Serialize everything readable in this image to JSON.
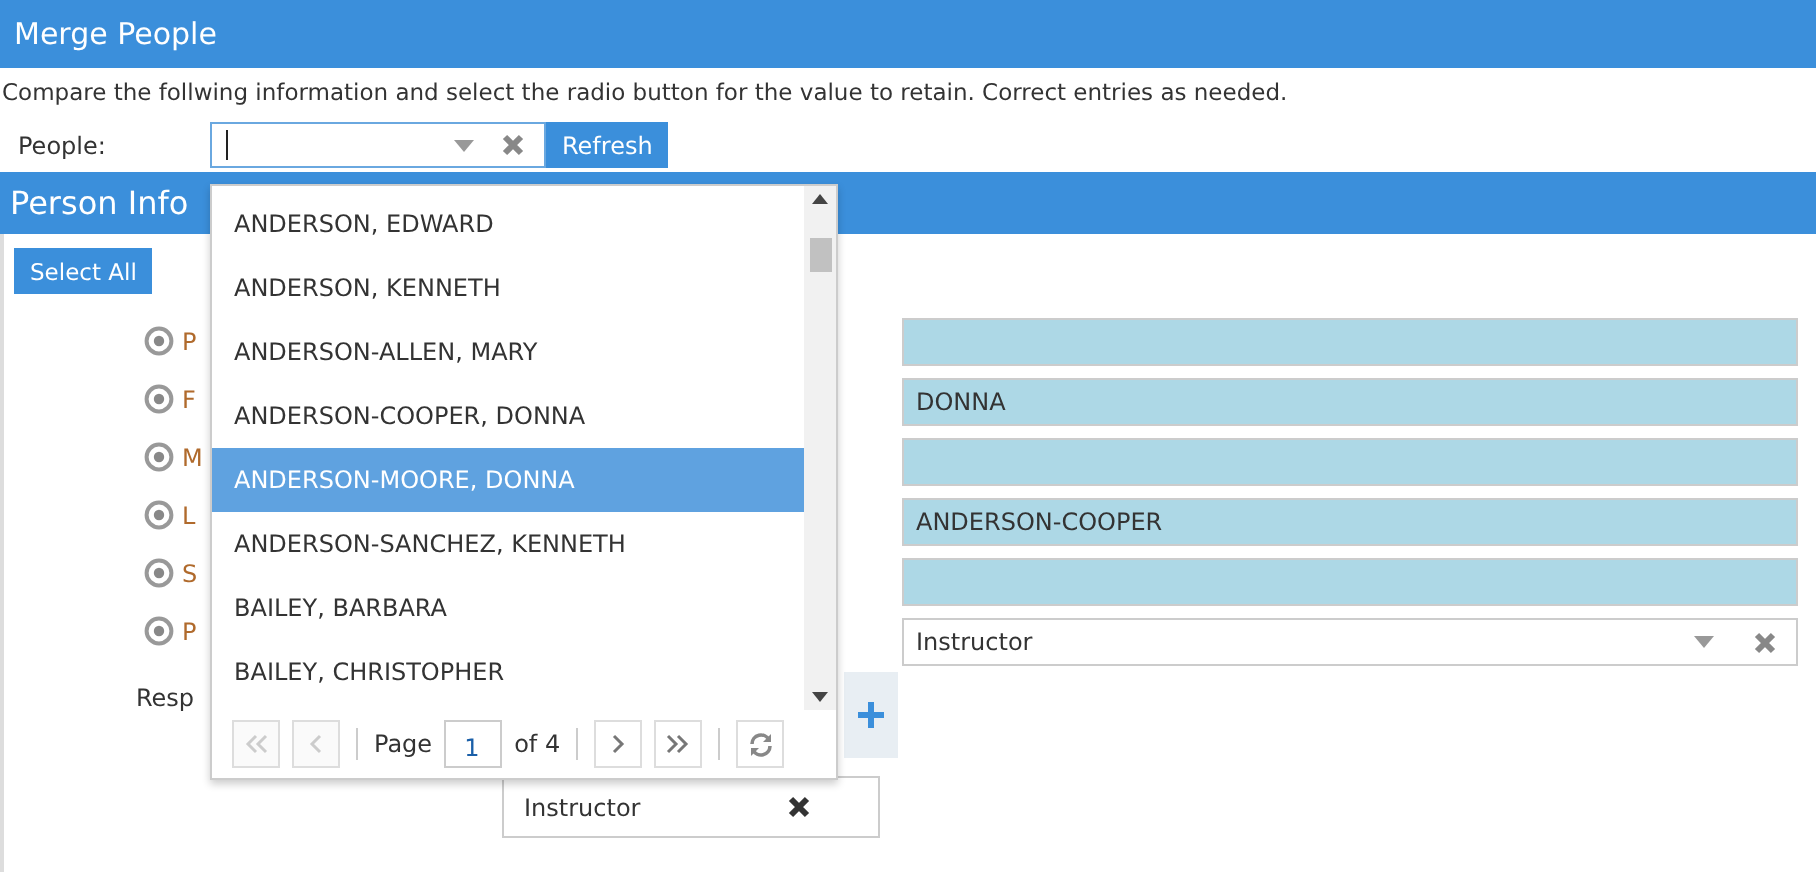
{
  "window": {
    "title": "Merge People"
  },
  "instructions": "Compare the follwing information and select the radio button for the value to retain. Correct entries as needed.",
  "people_field": {
    "label": "People:",
    "button": "Refresh"
  },
  "section": {
    "title": "Person Info",
    "select_all": "Select All"
  },
  "radio_rows": [
    {
      "label": "P",
      "selected": true
    },
    {
      "label": "F",
      "selected": true
    },
    {
      "label": "M",
      "selected": true
    },
    {
      "label": "L",
      "selected": true
    },
    {
      "label": "S",
      "selected": true
    },
    {
      "label": "P",
      "selected": true
    }
  ],
  "responsibility_label": "Resp",
  "fields": [
    {
      "kind": "text"
    },
    {
      "kind": "text",
      "value": "DONNA"
    },
    {
      "kind": "text"
    },
    {
      "kind": "text",
      "value": "ANDERSON-COOPER"
    },
    {
      "kind": "text"
    },
    {
      "kind": "select",
      "value": "Instructor"
    }
  ],
  "responsibility_tag": {
    "value": "Instructor"
  },
  "dropdown": {
    "items": [
      {
        "label": "ANDERSON, EDWARD",
        "selected": false
      },
      {
        "label": "ANDERSON, KENNETH",
        "selected": false
      },
      {
        "label": "ANDERSON-ALLEN, MARY",
        "selected": false
      },
      {
        "label": "ANDERSON-COOPER, DONNA",
        "selected": false
      },
      {
        "label": "ANDERSON-MOORE, DONNA",
        "selected": true
      },
      {
        "label": "ANDERSON-SANCHEZ, KENNETH",
        "selected": false
      },
      {
        "label": "BAILEY, BARBARA",
        "selected": false
      },
      {
        "label": "BAILEY, CHRISTOPHER",
        "selected": false
      }
    ],
    "pager": {
      "page_label": "Page",
      "page": "1",
      "of": "of 4"
    }
  }
}
